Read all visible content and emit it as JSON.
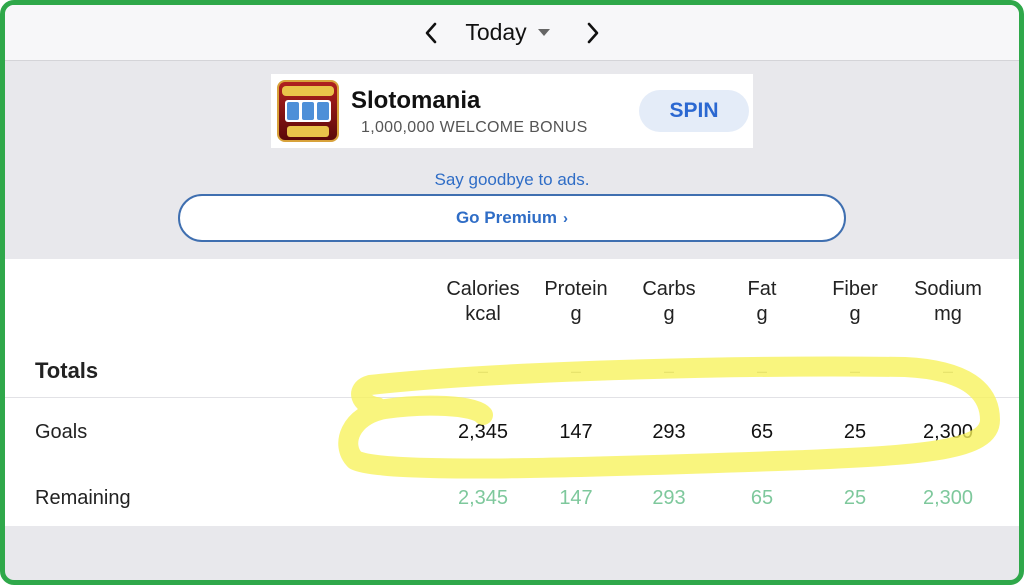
{
  "datebar": {
    "label": "Today"
  },
  "ad": {
    "title": "Slotomania",
    "subtitle": "1,000,000  WELCOME BONUS",
    "button": "SPIN"
  },
  "premium": {
    "goodbye": "Say goodbye to ads.",
    "button": "Go Premium",
    "chevron": "›"
  },
  "table": {
    "columns": [
      {
        "name": "Calories",
        "unit": "kcal"
      },
      {
        "name": "Protein",
        "unit": "g"
      },
      {
        "name": "Carbs",
        "unit": "g"
      },
      {
        "name": "Fat",
        "unit": "g"
      },
      {
        "name": "Fiber",
        "unit": "g"
      },
      {
        "name": "Sodium",
        "unit": "mg"
      }
    ],
    "rows": {
      "totals": {
        "label": "Totals",
        "values": [
          "–",
          "–",
          "–",
          "–",
          "–",
          "–"
        ]
      },
      "goals": {
        "label": "Goals",
        "values": [
          "2,345",
          "147",
          "293",
          "65",
          "25",
          "2,300"
        ]
      },
      "remaining": {
        "label": "Remaining",
        "values": [
          "2,345",
          "147",
          "293",
          "65",
          "25",
          "2,300"
        ]
      }
    }
  },
  "colors": {
    "frame": "#2fa84a",
    "accent_blue": "#2f6dc6",
    "remaining_green": "#7ec89c",
    "highlighter": "#f7f25a"
  }
}
